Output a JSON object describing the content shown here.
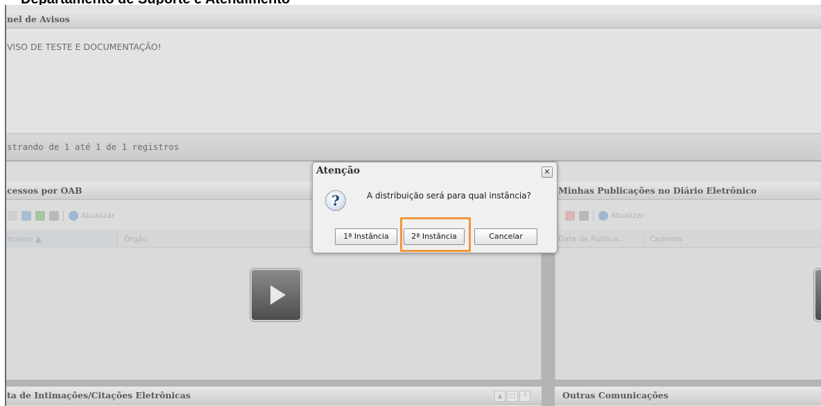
{
  "document": {
    "header_text": "Departamento de Suporte e Atendimento"
  },
  "avisos_panel": {
    "title": "nel de Avisos",
    "message": "VISO DE TESTE E DOCUMENTAÇÃO!",
    "pager_text": "strando de 1 até 1 de 1 registros"
  },
  "processos_panel": {
    "title": "cessos por OAB",
    "toolbar_refresh_label": "Atualizar",
    "columns": [
      "ocesso ▲",
      "Órgão"
    ]
  },
  "publicacoes_panel": {
    "title": "Minhas Publicações no Diário Eletrônico",
    "toolbar_refresh_label": "Atualizar",
    "columns": [
      "Data de Publica...",
      "Caderno"
    ]
  },
  "intimacoes_panel": {
    "title": "ta de Intimações/Citações Eletrônicas",
    "tool_buttons": [
      "▲",
      "□",
      "?"
    ]
  },
  "outras_panel": {
    "title": "Outras Comunicações"
  },
  "dialog": {
    "title": "Atenção",
    "close_glyph": "✕",
    "icon_glyph": "?",
    "message": "A distribuição será para qual instância?",
    "buttons": {
      "primeira": "1ª Instância",
      "segunda": "2ª Instância",
      "cancelar": "Cancelar"
    }
  },
  "colors": {
    "highlight": "#f0973a",
    "panel_title": "#5a5a5a",
    "dialog_background": "#f0f0f0"
  }
}
